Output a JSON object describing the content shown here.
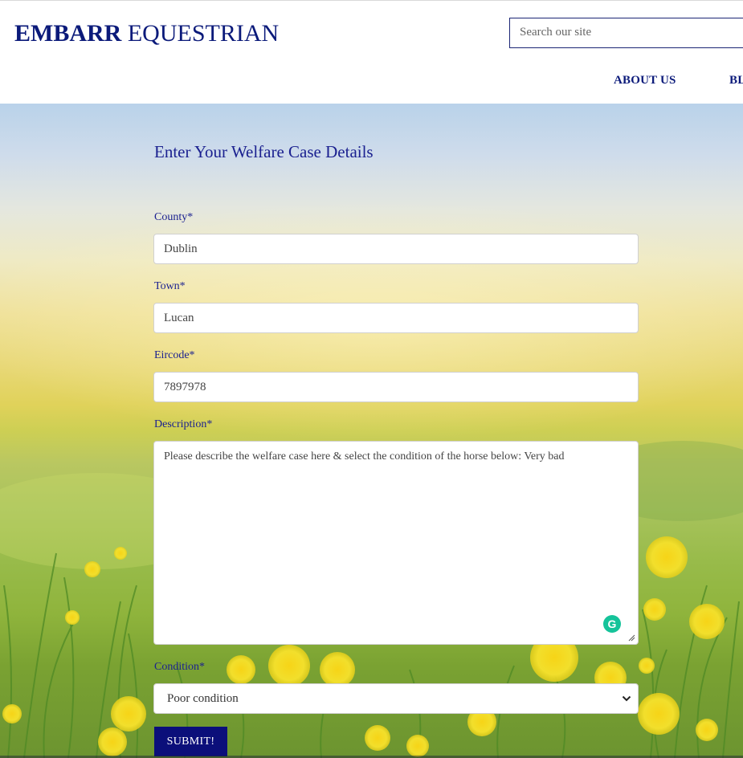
{
  "header": {
    "brand_bold": "EMBARR",
    "brand_rest": " EQUESTRIAN",
    "search_placeholder": "Search our site",
    "nav": [
      {
        "label": "ABOUT US"
      },
      {
        "label": "BL"
      }
    ]
  },
  "form": {
    "title": "Enter Your Welfare Case Details",
    "county": {
      "label": "County*",
      "value": "Dublin"
    },
    "town": {
      "label": "Town*",
      "value": "Lucan"
    },
    "eircode": {
      "label": "Eircode*",
      "value": "7897978"
    },
    "description": {
      "label": "Description*",
      "value": "Please describe the welfare case here & select the condition of the horse below: Very bad"
    },
    "condition": {
      "label": "Condition*",
      "value": "Poor condition"
    },
    "submit_label": "SUBMIT!"
  },
  "icons": {
    "grammarly": "grammarly-icon",
    "grammarly_glyph": "G",
    "chevron": "chevron-down-icon",
    "resize": "resize-handle-icon"
  },
  "colors": {
    "brand": "#0b1a7a",
    "label": "#1b2190",
    "submit_bg": "#0b0f7a",
    "grammarly": "#15c39a"
  }
}
